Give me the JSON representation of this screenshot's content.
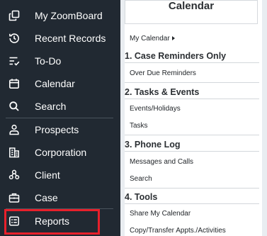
{
  "sidebar": {
    "items": [
      {
        "label": "My ZoomBoard",
        "icon": "zoomboard-icon"
      },
      {
        "label": "Recent Records",
        "icon": "history-icon"
      },
      {
        "label": "To-Do",
        "icon": "todo-list-icon"
      },
      {
        "label": "Calendar",
        "icon": "calendar-icon"
      },
      {
        "label": "Search",
        "icon": "search-icon"
      },
      {
        "label": "Prospects",
        "icon": "prospect-person-icon"
      },
      {
        "label": "Corporation",
        "icon": "building-icon"
      },
      {
        "label": "Client",
        "icon": "client-group-icon"
      },
      {
        "label": "Case",
        "icon": "briefcase-icon"
      },
      {
        "label": "Reports",
        "icon": "reports-icon"
      }
    ]
  },
  "calendar_menu": {
    "title": "Calendar",
    "my_calendar": "My Calendar",
    "sections": [
      {
        "title": "1. Case Reminders Only",
        "links": [
          "Over Due Reminders"
        ]
      },
      {
        "title": "2. Tasks & Events",
        "links": [
          "Events/Holidays",
          "Tasks"
        ]
      },
      {
        "title": "3. Phone Log",
        "links": [
          "Messages and Calls",
          "Search"
        ]
      },
      {
        "title": "4. Tools",
        "links": [
          "Share My Calendar",
          "Copy/Transfer Appts./Activities"
        ]
      }
    ]
  },
  "colors": {
    "sidebar_bg": "#212932",
    "highlight_border": "#e8202b",
    "panel_bg": "#ffffff"
  }
}
